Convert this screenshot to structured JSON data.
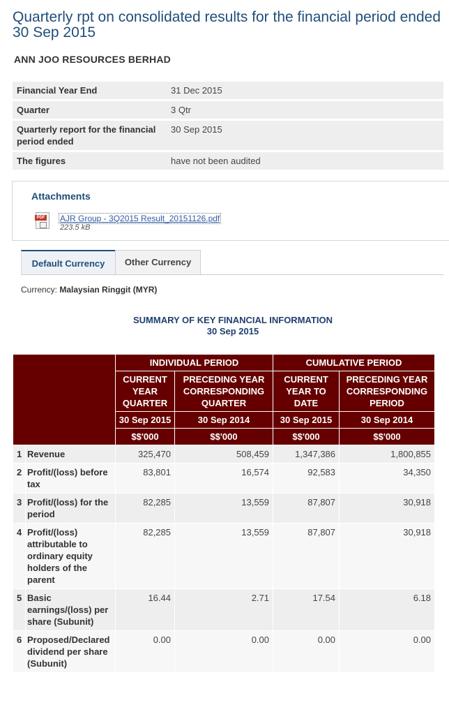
{
  "page": {
    "title": "Quarterly rpt on consolidated results for the financial period ended 30 Sep 2015",
    "company": "ANN JOO RESOURCES BERHAD"
  },
  "info_rows": [
    {
      "label": "Financial Year End",
      "value": "31 Dec 2015"
    },
    {
      "label": "Quarter",
      "value": "3 Qtr"
    },
    {
      "label": "Quarterly report for the financial period ended",
      "value": "30 Sep 2015"
    },
    {
      "label": "The figures",
      "value": "have not been audited"
    }
  ],
  "attachments": {
    "title": "Attachments",
    "icon": "pdf-icon",
    "icon_text": "PDF",
    "file_name": "AJR Group - 3Q2015 Result_20151126.pdf",
    "file_size": "223.5 kB"
  },
  "tabs": [
    {
      "label": "Default Currency",
      "active": true
    },
    {
      "label": "Other Currency",
      "active": false
    }
  ],
  "currency": {
    "label": "Currency:",
    "value": "Malaysian Ringgit (MYR)"
  },
  "summary": {
    "title": "SUMMARY OF KEY FINANCIAL INFORMATION",
    "date": "30 Sep 2015"
  },
  "table": {
    "group_headers": [
      "INDIVIDUAL PERIOD",
      "CUMULATIVE PERIOD"
    ],
    "col_headers": [
      "CURRENT YEAR QUARTER",
      "PRECEDING YEAR CORRESPONDING QUARTER",
      "CURRENT YEAR TO DATE",
      "PRECEDING YEAR CORRESPONDING PERIOD"
    ],
    "dates": [
      "30 Sep 2015",
      "30 Sep 2014",
      "30 Sep 2015",
      "30 Sep 2014"
    ],
    "units": [
      "$$'000",
      "$$'000",
      "$$'000",
      "$$'000"
    ],
    "rows": [
      {
        "no": "1",
        "label": "Revenue",
        "values": [
          "325,470",
          "508,459",
          "1,347,386",
          "1,800,855"
        ]
      },
      {
        "no": "2",
        "label": "Profit/(loss) before tax",
        "values": [
          "83,801",
          "16,574",
          "92,583",
          "34,350"
        ]
      },
      {
        "no": "3",
        "label": "Profit/(loss) for the period",
        "values": [
          "82,285",
          "13,559",
          "87,807",
          "30,918"
        ]
      },
      {
        "no": "4",
        "label": "Profit/(loss) attributable to ordinary equity holders of the parent",
        "values": [
          "82,285",
          "13,559",
          "87,807",
          "30,918"
        ]
      },
      {
        "no": "5",
        "label": "Basic earnings/(loss) per share (Subunit)",
        "values": [
          "16.44",
          "2.71",
          "17.54",
          "6.18"
        ]
      },
      {
        "no": "6",
        "label": "Proposed/Declared dividend per share (Subunit)",
        "values": [
          "0.00",
          "0.00",
          "0.00",
          "0.00"
        ]
      }
    ]
  },
  "colors": {
    "header_bg": "#660000",
    "title": "#1f4e79",
    "link": "#2e5da8"
  }
}
